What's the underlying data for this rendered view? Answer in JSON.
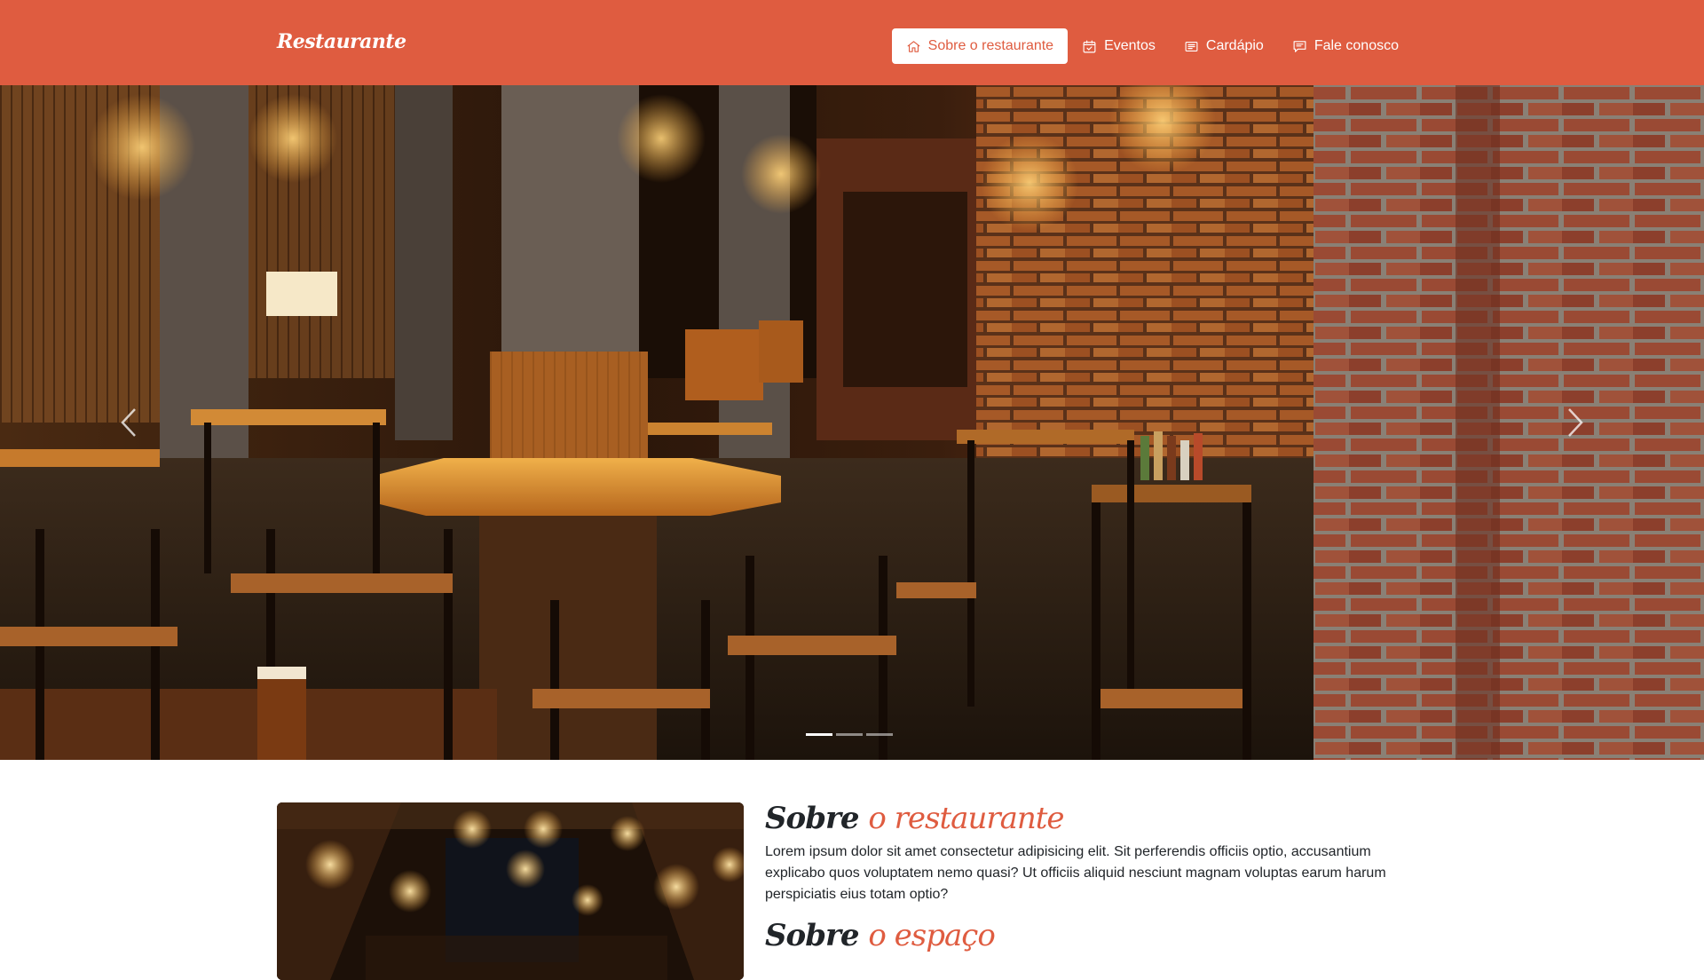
{
  "navbar": {
    "brand": "Restaurante",
    "items": [
      {
        "label": "Sobre o restaurante",
        "icon": "home-icon",
        "active": true
      },
      {
        "label": "Eventos",
        "icon": "calendar-check-icon",
        "active": false
      },
      {
        "label": "Cardápio",
        "icon": "menu-card-icon",
        "active": false
      },
      {
        "label": "Fale conosco",
        "icon": "chat-icon",
        "active": false
      }
    ]
  },
  "carousel": {
    "slides": 3,
    "active_index": 0,
    "prev_icon": "chevron-left-icon",
    "next_icon": "chevron-right-icon"
  },
  "about": {
    "title_part1": "Sobre",
    "title_part2": "o restaurante",
    "text": "Lorem ipsum dolor sit amet consectetur adipisicing elit. Sit perferendis officiis optio, accusantium explicabo quos voluptatem nemo quasi? Ut officiis aliquid nesciunt magnam voluptas earum harum perspiciatis eius totam optio?",
    "subtitle_part1": "Sobre",
    "subtitle_part2": "o espaço"
  },
  "colors": {
    "brand": "#df5c40",
    "text": "#212529"
  }
}
